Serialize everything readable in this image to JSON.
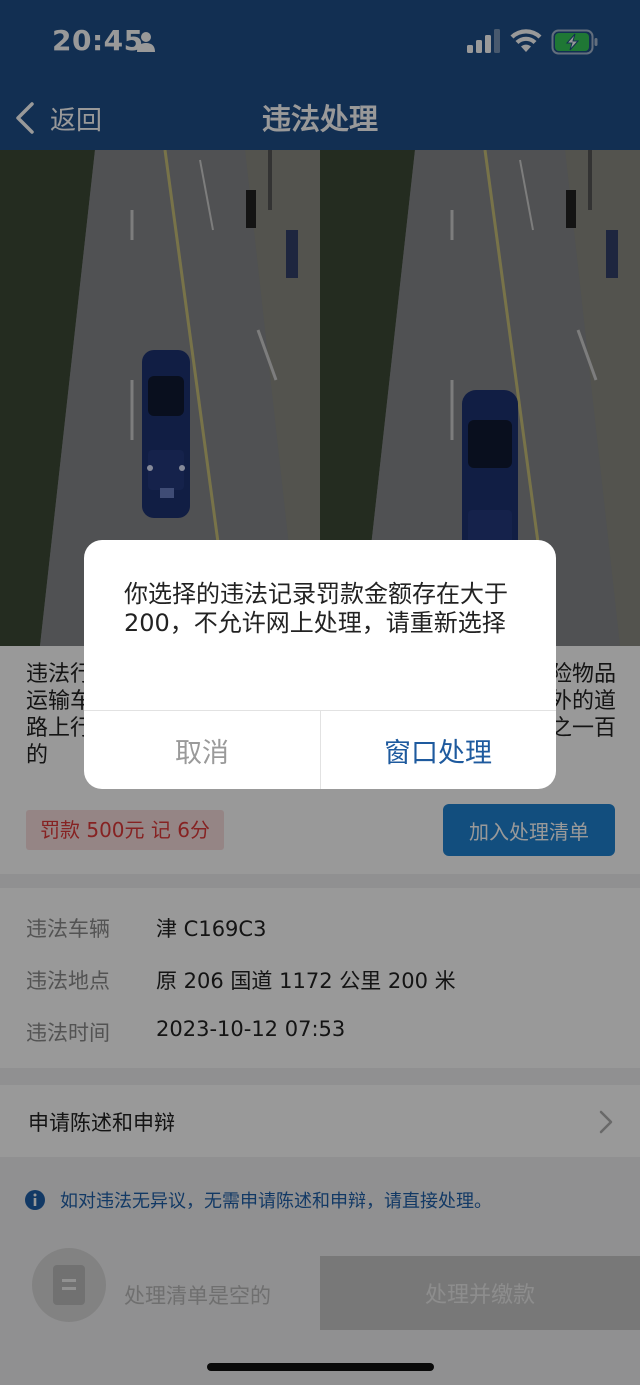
{
  "status_bar": {
    "time": "20:45",
    "icons": [
      "person-icon",
      "signal-icon",
      "wifi-icon",
      "battery-charging-icon"
    ]
  },
  "nav": {
    "back_label": "返回",
    "title": "违法处理"
  },
  "violation": {
    "description_left": "违法行\n运输车\n路上行\n的",
    "description_right": "险物品\n外的道\n之一百",
    "fine_badge": "罚款 500元  记 6分",
    "add_button": "加入处理清单"
  },
  "details": [
    {
      "label": "违法车辆",
      "value": "津 C169C3"
    },
    {
      "label": "违法地点",
      "value": "原 206 国道 1172 公里 200 米"
    },
    {
      "label": "违法时间",
      "value": "2023-10-12 07:53"
    }
  ],
  "appeal": {
    "label": "申请陈述和申辩"
  },
  "tip": {
    "text": "如对违法无异议，无需申请陈述和申辩，请直接处理。"
  },
  "bottom": {
    "empty_text": "处理清单是空的",
    "pay_button": "处理并缴款"
  },
  "dialog": {
    "message": "你选择的违法记录罚款金额存在大于200，不允许网上处理，请重新选择",
    "cancel": "取消",
    "confirm": "窗口处理"
  },
  "colors": {
    "header": "#1e4f89",
    "accent": "#1e82d2",
    "fine": "#e03a3a",
    "tip": "#1f5fa8"
  }
}
